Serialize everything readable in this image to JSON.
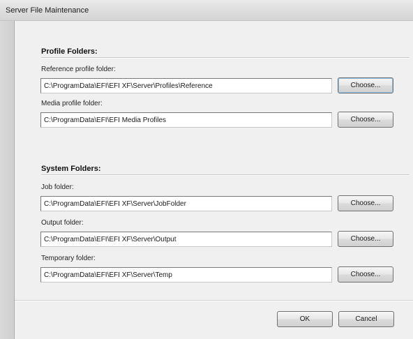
{
  "window": {
    "title": "Server File Maintenance"
  },
  "profile_folders": {
    "header": "Profile Folders:",
    "reference": {
      "label": "Reference profile folder:",
      "value": "C:\\ProgramData\\EFI\\EFI XF\\Server\\Profiles\\Reference",
      "button": "Choose..."
    },
    "media": {
      "label": "Media profile folder:",
      "value": "C:\\ProgramData\\EFI\\EFI Media Profiles",
      "button": "Choose..."
    }
  },
  "system_folders": {
    "header": "System Folders:",
    "job": {
      "label": "Job folder:",
      "value": "C:\\ProgramData\\EFI\\EFI XF\\Server\\JobFolder",
      "button": "Choose..."
    },
    "output": {
      "label": "Output folder:",
      "value": "C:\\ProgramData\\EFI\\EFI XF\\Server\\Output",
      "button": "Choose..."
    },
    "temporary": {
      "label": "Temporary folder:",
      "value": "C:\\ProgramData\\EFI\\EFI XF\\Server\\Temp",
      "button": "Choose..."
    }
  },
  "footer": {
    "ok_label": "OK",
    "cancel_label": "Cancel"
  }
}
